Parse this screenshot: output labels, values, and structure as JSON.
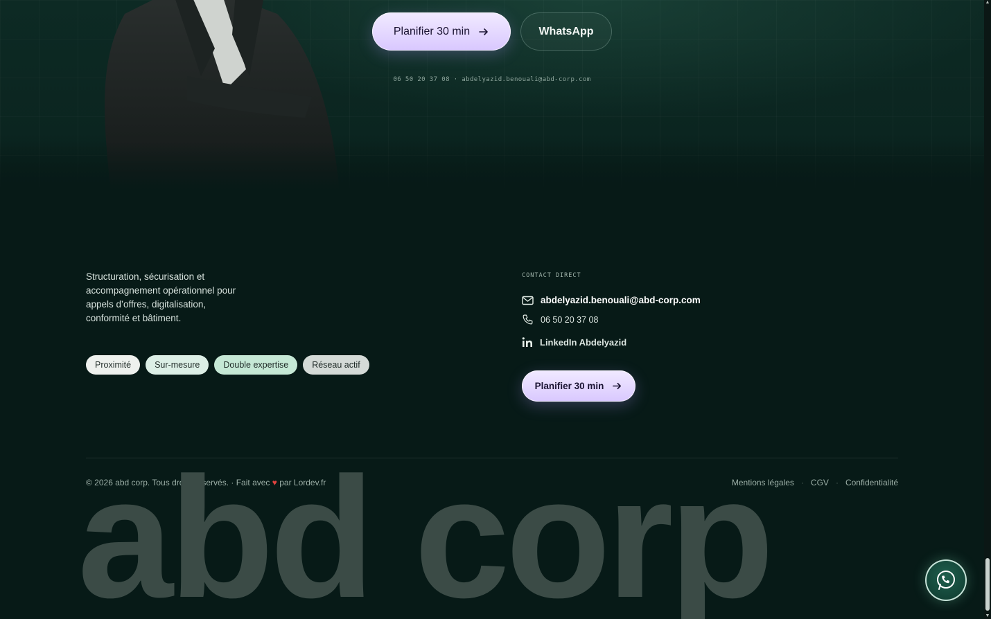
{
  "hero": {
    "cta_label": "Planifier 30 min",
    "whatsapp_label": "WhatsApp",
    "contact_line": "06 50 20 37 08 · abdelyazid.benouali@abd-corp.com"
  },
  "about": {
    "tagline": "Structuration, sécurisation et accompagnement opérationnel pour appels d’offres, digitalisation, conformité et bâtiment.",
    "chips": [
      "Proximité",
      "Sur-mesure",
      "Double expertise",
      "Réseau actif"
    ]
  },
  "contact": {
    "section_label": "CONTACT DIRECT",
    "email": "abdelyazid.benouali@abd-corp.com",
    "phone": "06 50 20 37 08",
    "linkedin": "LinkedIn Abdelyazid",
    "cta_label": "Planifier 30 min"
  },
  "footer": {
    "copyright_prefix": "© 2026 abd corp. Tous droits réservés. · Fait avec",
    "heart": "♥",
    "copyright_suffix": "par Lordev.fr",
    "links": [
      "Mentions légales",
      "CGV",
      "Confidentialité"
    ],
    "separator": "·",
    "wordmark": "abd corp"
  },
  "colors": {
    "background": "#071a17",
    "primary_button": "#e3d6ff",
    "chip_mint": "#c5e8d5",
    "heart": "#e0433f"
  }
}
